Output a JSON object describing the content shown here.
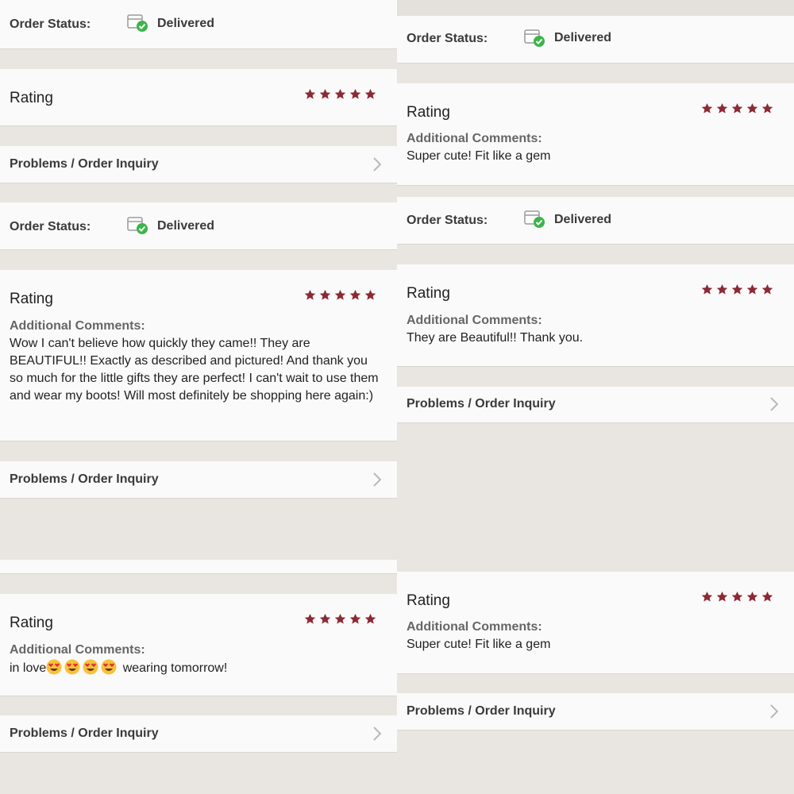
{
  "colors": {
    "background": "#e9e6e1",
    "panel": "#fbfafa",
    "star": "#8b2a35",
    "check_green": "#3bb54a",
    "chevron": "#b9b9b9"
  },
  "labels": {
    "order_status": "Order Status:",
    "delivered": "Delivered",
    "rating": "Rating",
    "additional_comments": "Additional Comments:",
    "problems": "Problems / Order Inquiry"
  },
  "ratings": {
    "review_1": 5,
    "review_2": 5,
    "review_3": 5,
    "review_4": 5,
    "review_5": 5,
    "review_6": 5
  },
  "comments": {
    "left_2": "Wow I can't believe how quickly they came!! They are BEAUTIFUL!! Exactly as described and pictured! And thank you so much for the little gifts they are perfect! I can't wait to use them and wear my boots! Will most definitely be shopping here again:)",
    "left_3_before": "in love",
    "left_3_after": " wearing tomorrow!",
    "right_1": "Super cute! Fit like a gem",
    "right_2": "They are Beautiful!! Thank you.",
    "right_3": "Super cute! Fit like a gem"
  },
  "icons": {
    "status": "delivered-box-check-icon",
    "star": "star-icon",
    "chevron": "chevron-right-icon",
    "emoji": "heart-eyes-emoji-icon"
  }
}
